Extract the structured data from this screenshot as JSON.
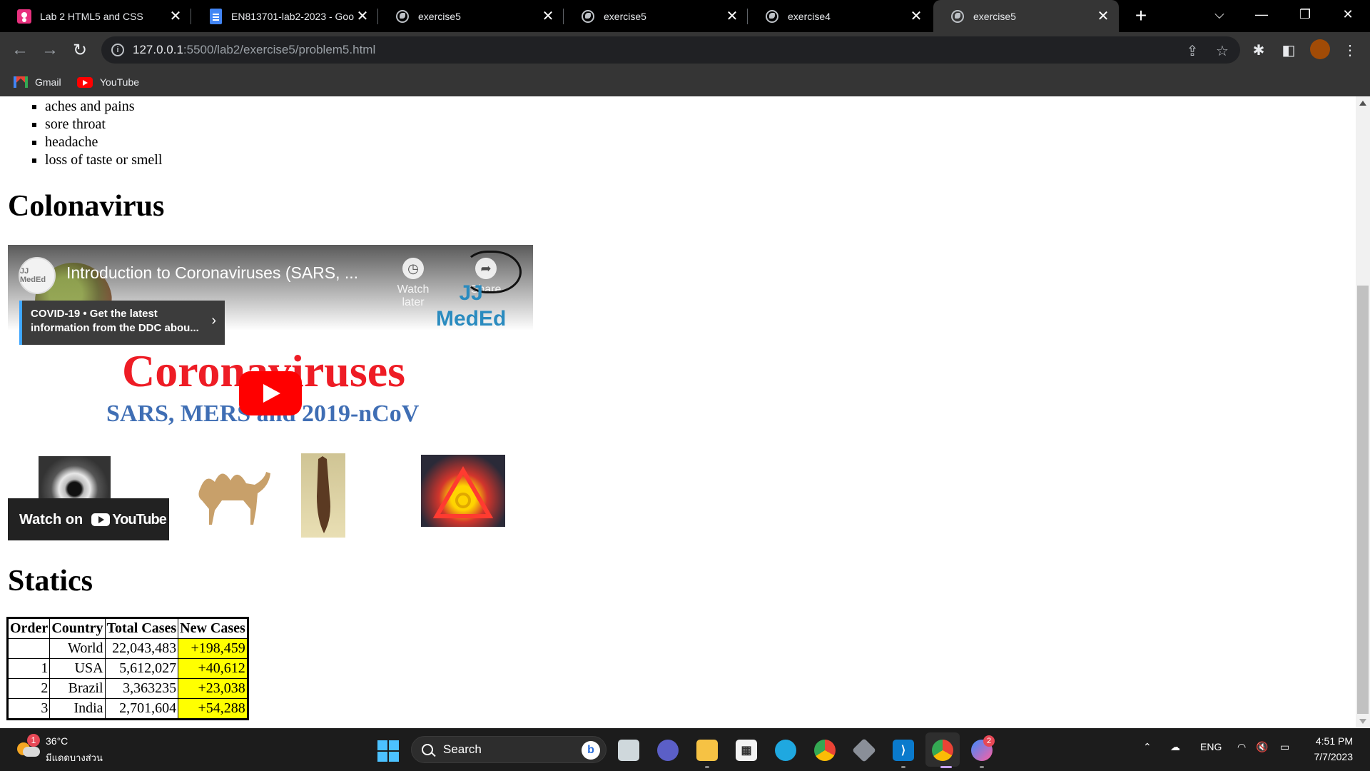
{
  "browser": {
    "tabs": [
      {
        "title": "Lab 2 HTML5 and CSS",
        "favicon": "classroom-icon"
      },
      {
        "title": "EN813701-lab2-2023 - Goo",
        "favicon": "google-docs-icon"
      },
      {
        "title": "exercise5",
        "favicon": "globe-icon"
      },
      {
        "title": "exercise5",
        "favicon": "globe-icon"
      },
      {
        "title": "exercise4",
        "favicon": "globe-icon"
      },
      {
        "title": "exercise5",
        "favicon": "globe-icon",
        "active": true
      }
    ],
    "url_host": "127.0.0.1",
    "url_path": ":5500/lab2/exercise5/problem5.html",
    "bookmarks": [
      {
        "label": "Gmail"
      },
      {
        "label": "YouTube"
      }
    ],
    "colors": {
      "tabstrip": "#000000",
      "toolbar": "#353535",
      "avatar": "#a14b06"
    }
  },
  "page": {
    "symptoms": [
      "aches and pains",
      "sore throat",
      "headache",
      "loss of taste or smell"
    ],
    "video_heading": "Colonavirus",
    "video": {
      "channel_logo_text": "JJ MedEd",
      "title": "Introduction to Coronaviruses (SARS, ...",
      "watch_later": "Watch later",
      "share": "Share",
      "info_card_line1": "COVID-19 • Get the latest",
      "info_card_line2": "information from the DDC abou...",
      "brand_line1": "JJ",
      "brand_line2": "MedEd",
      "big_title": "Coronaviruses",
      "subtitle": "SARS, MERS and 2019-nCoV",
      "watch_on": "Watch on",
      "youtube_wordmark": "YouTube"
    },
    "stats_heading": "Statics",
    "table": {
      "headers": [
        "Order",
        "Country",
        "Total Cases",
        "New Cases"
      ],
      "rows": [
        {
          "order": "",
          "country": "World",
          "total": "22,043,483",
          "new": "+198,459"
        },
        {
          "order": "1",
          "country": "USA",
          "total": "5,612,027",
          "new": "+40,612"
        },
        {
          "order": "2",
          "country": "Brazil",
          "total": "3,363235",
          "new": "+23,038"
        },
        {
          "order": "3",
          "country": "India",
          "total": "2,701,604",
          "new": "+54,288"
        }
      ],
      "highlight_color": "#ffff00"
    }
  },
  "taskbar": {
    "weather_badge": "1",
    "weather_temp": "36°C",
    "weather_desc": "มีแดดบางส่วน",
    "search_label": "Search",
    "messenger_badge": "2",
    "language": "ENG",
    "time": "4:51 PM",
    "date": "7/7/2023"
  }
}
